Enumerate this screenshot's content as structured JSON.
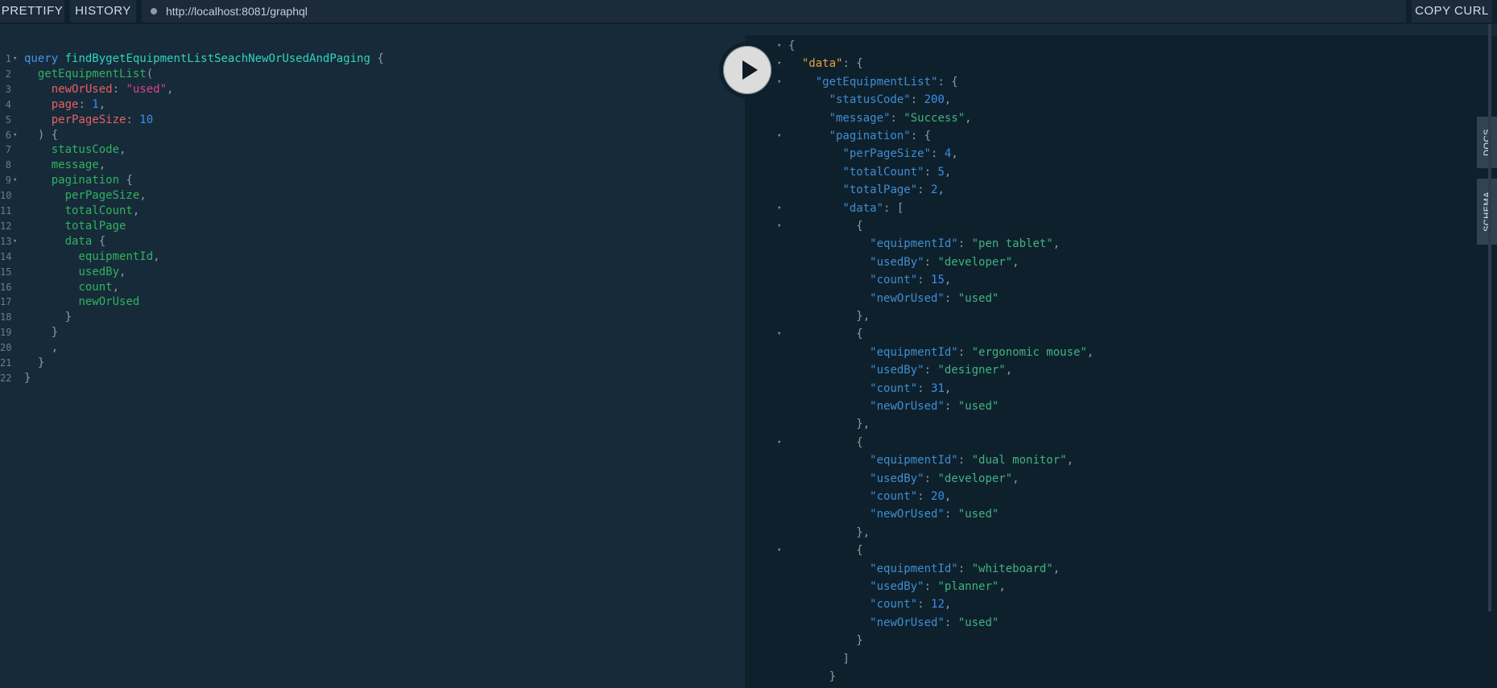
{
  "toolbar": {
    "prettify_label": "PRETTIFY",
    "history_label": "HISTORY",
    "endpoint_url": "http://localhost:8081/graphql",
    "copy_curl_label": "COPY CURL"
  },
  "sidebar_tabs": {
    "docs_label": "DOCS",
    "schema_label": "SCHEMA"
  },
  "query_lines": [
    {
      "n": "1",
      "fold": true,
      "tokens": [
        {
          "t": "query",
          "c": "kw"
        },
        {
          "t": " "
        },
        {
          "t": "findBygetEquipmentListSeachNewOrUsedAndPaging",
          "c": "fn"
        },
        {
          "t": " {",
          "c": "pun"
        }
      ]
    },
    {
      "n": "2",
      "tokens": [
        {
          "t": "  "
        },
        {
          "t": "getEquipmentList",
          "c": "fld"
        },
        {
          "t": "(",
          "c": "pun"
        }
      ]
    },
    {
      "n": "3",
      "tokens": [
        {
          "t": "    "
        },
        {
          "t": "newOrUsed",
          "c": "arg"
        },
        {
          "t": ": ",
          "c": "pun"
        },
        {
          "t": "\"used\"",
          "c": "str"
        },
        {
          "t": ",",
          "c": "pun"
        }
      ]
    },
    {
      "n": "4",
      "tokens": [
        {
          "t": "    "
        },
        {
          "t": "page",
          "c": "arg"
        },
        {
          "t": ": ",
          "c": "pun"
        },
        {
          "t": "1",
          "c": "num"
        },
        {
          "t": ",",
          "c": "pun"
        }
      ]
    },
    {
      "n": "5",
      "tokens": [
        {
          "t": "    "
        },
        {
          "t": "perPageSize",
          "c": "arg"
        },
        {
          "t": ": ",
          "c": "pun"
        },
        {
          "t": "10",
          "c": "num"
        }
      ]
    },
    {
      "n": "6",
      "fold": true,
      "tokens": [
        {
          "t": "  "
        },
        {
          "t": ") {",
          "c": "pun"
        }
      ]
    },
    {
      "n": "7",
      "tokens": [
        {
          "t": "    "
        },
        {
          "t": "statusCode",
          "c": "fld"
        },
        {
          "t": ",",
          "c": "pun"
        }
      ]
    },
    {
      "n": "8",
      "tokens": [
        {
          "t": "    "
        },
        {
          "t": "message",
          "c": "fld"
        },
        {
          "t": ",",
          "c": "pun"
        }
      ]
    },
    {
      "n": "9",
      "fold": true,
      "tokens": [
        {
          "t": "    "
        },
        {
          "t": "pagination",
          "c": "fld"
        },
        {
          "t": " {",
          "c": "pun"
        }
      ]
    },
    {
      "n": "10",
      "tokens": [
        {
          "t": "      "
        },
        {
          "t": "perPageSize",
          "c": "fld"
        },
        {
          "t": ",",
          "c": "pun"
        }
      ]
    },
    {
      "n": "11",
      "tokens": [
        {
          "t": "      "
        },
        {
          "t": "totalCount",
          "c": "fld"
        },
        {
          "t": ",",
          "c": "pun"
        }
      ]
    },
    {
      "n": "12",
      "tokens": [
        {
          "t": "      "
        },
        {
          "t": "totalPage",
          "c": "fld"
        }
      ]
    },
    {
      "n": "13",
      "fold": true,
      "tokens": [
        {
          "t": "      "
        },
        {
          "t": "data",
          "c": "fld"
        },
        {
          "t": " {",
          "c": "pun"
        }
      ]
    },
    {
      "n": "14",
      "tokens": [
        {
          "t": "        "
        },
        {
          "t": "equipmentId",
          "c": "fld"
        },
        {
          "t": ",",
          "c": "pun"
        }
      ]
    },
    {
      "n": "15",
      "tokens": [
        {
          "t": "        "
        },
        {
          "t": "usedBy",
          "c": "fld"
        },
        {
          "t": ",",
          "c": "pun"
        }
      ]
    },
    {
      "n": "16",
      "tokens": [
        {
          "t": "        "
        },
        {
          "t": "count",
          "c": "fld"
        },
        {
          "t": ",",
          "c": "pun"
        }
      ]
    },
    {
      "n": "17",
      "tokens": [
        {
          "t": "        "
        },
        {
          "t": "newOrUsed",
          "c": "fld"
        }
      ]
    },
    {
      "n": "18",
      "tokens": [
        {
          "t": "      "
        },
        {
          "t": "}",
          "c": "pun"
        }
      ]
    },
    {
      "n": "19",
      "tokens": [
        {
          "t": "    "
        },
        {
          "t": "}",
          "c": "pun"
        }
      ]
    },
    {
      "n": "20",
      "tokens": [
        {
          "t": "    "
        },
        {
          "t": ",",
          "c": "pun"
        }
      ]
    },
    {
      "n": "21",
      "tokens": [
        {
          "t": "  "
        },
        {
          "t": "}",
          "c": "pun"
        }
      ]
    },
    {
      "n": "22",
      "tokens": [
        {
          "t": "}",
          "c": "pun"
        }
      ]
    }
  ],
  "result_lines": [
    {
      "fold": true,
      "tokens": [
        {
          "t": "{",
          "c": "pun"
        }
      ]
    },
    {
      "fold": true,
      "tokens": [
        {
          "t": "  "
        },
        {
          "t": "\"data\"",
          "c": "rkey-data"
        },
        {
          "t": ": {",
          "c": "pun"
        }
      ]
    },
    {
      "fold": true,
      "tokens": [
        {
          "t": "    "
        },
        {
          "t": "\"getEquipmentList\"",
          "c": "key"
        },
        {
          "t": ": {",
          "c": "pun"
        }
      ]
    },
    {
      "tokens": [
        {
          "t": "      "
        },
        {
          "t": "\"statusCode\"",
          "c": "key"
        },
        {
          "t": ": ",
          "c": "pun"
        },
        {
          "t": "200",
          "c": "rnum"
        },
        {
          "t": ",",
          "c": "pun"
        }
      ]
    },
    {
      "tokens": [
        {
          "t": "      "
        },
        {
          "t": "\"message\"",
          "c": "key"
        },
        {
          "t": ": ",
          "c": "pun"
        },
        {
          "t": "\"Success\"",
          "c": "rstr"
        },
        {
          "t": ",",
          "c": "pun"
        }
      ]
    },
    {
      "fold": true,
      "tokens": [
        {
          "t": "      "
        },
        {
          "t": "\"pagination\"",
          "c": "key"
        },
        {
          "t": ": {",
          "c": "pun"
        }
      ]
    },
    {
      "tokens": [
        {
          "t": "        "
        },
        {
          "t": "\"perPageSize\"",
          "c": "key"
        },
        {
          "t": ": ",
          "c": "pun"
        },
        {
          "t": "4",
          "c": "rnum"
        },
        {
          "t": ",",
          "c": "pun"
        }
      ]
    },
    {
      "tokens": [
        {
          "t": "        "
        },
        {
          "t": "\"totalCount\"",
          "c": "key"
        },
        {
          "t": ": ",
          "c": "pun"
        },
        {
          "t": "5",
          "c": "rnum"
        },
        {
          "t": ",",
          "c": "pun"
        }
      ]
    },
    {
      "tokens": [
        {
          "t": "        "
        },
        {
          "t": "\"totalPage\"",
          "c": "key"
        },
        {
          "t": ": ",
          "c": "pun"
        },
        {
          "t": "2",
          "c": "rnum"
        },
        {
          "t": ",",
          "c": "pun"
        }
      ]
    },
    {
      "fold": true,
      "tokens": [
        {
          "t": "        "
        },
        {
          "t": "\"data\"",
          "c": "key"
        },
        {
          "t": ": [",
          "c": "pun"
        }
      ]
    },
    {
      "fold": true,
      "tokens": [
        {
          "t": "          "
        },
        {
          "t": "{",
          "c": "pun"
        }
      ]
    },
    {
      "tokens": [
        {
          "t": "            "
        },
        {
          "t": "\"equipmentId\"",
          "c": "key"
        },
        {
          "t": ": ",
          "c": "pun"
        },
        {
          "t": "\"pen tablet\"",
          "c": "rstr"
        },
        {
          "t": ",",
          "c": "pun"
        }
      ]
    },
    {
      "tokens": [
        {
          "t": "            "
        },
        {
          "t": "\"usedBy\"",
          "c": "key"
        },
        {
          "t": ": ",
          "c": "pun"
        },
        {
          "t": "\"developer\"",
          "c": "rstr"
        },
        {
          "t": ",",
          "c": "pun"
        }
      ]
    },
    {
      "tokens": [
        {
          "t": "            "
        },
        {
          "t": "\"count\"",
          "c": "key"
        },
        {
          "t": ": ",
          "c": "pun"
        },
        {
          "t": "15",
          "c": "rnum"
        },
        {
          "t": ",",
          "c": "pun"
        }
      ]
    },
    {
      "tokens": [
        {
          "t": "            "
        },
        {
          "t": "\"newOrUsed\"",
          "c": "key"
        },
        {
          "t": ": ",
          "c": "pun"
        },
        {
          "t": "\"used\"",
          "c": "rstr"
        }
      ]
    },
    {
      "tokens": [
        {
          "t": "          "
        },
        {
          "t": "},",
          "c": "pun"
        }
      ]
    },
    {
      "fold": true,
      "tokens": [
        {
          "t": "          "
        },
        {
          "t": "{",
          "c": "pun"
        }
      ]
    },
    {
      "tokens": [
        {
          "t": "            "
        },
        {
          "t": "\"equipmentId\"",
          "c": "key"
        },
        {
          "t": ": ",
          "c": "pun"
        },
        {
          "t": "\"ergonomic mouse\"",
          "c": "rstr"
        },
        {
          "t": ",",
          "c": "pun"
        }
      ]
    },
    {
      "tokens": [
        {
          "t": "            "
        },
        {
          "t": "\"usedBy\"",
          "c": "key"
        },
        {
          "t": ": ",
          "c": "pun"
        },
        {
          "t": "\"designer\"",
          "c": "rstr"
        },
        {
          "t": ",",
          "c": "pun"
        }
      ]
    },
    {
      "tokens": [
        {
          "t": "            "
        },
        {
          "t": "\"count\"",
          "c": "key"
        },
        {
          "t": ": ",
          "c": "pun"
        },
        {
          "t": "31",
          "c": "rnum"
        },
        {
          "t": ",",
          "c": "pun"
        }
      ]
    },
    {
      "tokens": [
        {
          "t": "            "
        },
        {
          "t": "\"newOrUsed\"",
          "c": "key"
        },
        {
          "t": ": ",
          "c": "pun"
        },
        {
          "t": "\"used\"",
          "c": "rstr"
        }
      ]
    },
    {
      "tokens": [
        {
          "t": "          "
        },
        {
          "t": "},",
          "c": "pun"
        }
      ]
    },
    {
      "fold": true,
      "tokens": [
        {
          "t": "          "
        },
        {
          "t": "{",
          "c": "pun"
        }
      ]
    },
    {
      "tokens": [
        {
          "t": "            "
        },
        {
          "t": "\"equipmentId\"",
          "c": "key"
        },
        {
          "t": ": ",
          "c": "pun"
        },
        {
          "t": "\"dual monitor\"",
          "c": "rstr"
        },
        {
          "t": ",",
          "c": "pun"
        }
      ]
    },
    {
      "tokens": [
        {
          "t": "            "
        },
        {
          "t": "\"usedBy\"",
          "c": "key"
        },
        {
          "t": ": ",
          "c": "pun"
        },
        {
          "t": "\"developer\"",
          "c": "rstr"
        },
        {
          "t": ",",
          "c": "pun"
        }
      ]
    },
    {
      "tokens": [
        {
          "t": "            "
        },
        {
          "t": "\"count\"",
          "c": "key"
        },
        {
          "t": ": ",
          "c": "pun"
        },
        {
          "t": "20",
          "c": "rnum"
        },
        {
          "t": ",",
          "c": "pun"
        }
      ]
    },
    {
      "tokens": [
        {
          "t": "            "
        },
        {
          "t": "\"newOrUsed\"",
          "c": "key"
        },
        {
          "t": ": ",
          "c": "pun"
        },
        {
          "t": "\"used\"",
          "c": "rstr"
        }
      ]
    },
    {
      "tokens": [
        {
          "t": "          "
        },
        {
          "t": "},",
          "c": "pun"
        }
      ]
    },
    {
      "fold": true,
      "tokens": [
        {
          "t": "          "
        },
        {
          "t": "{",
          "c": "pun"
        }
      ]
    },
    {
      "tokens": [
        {
          "t": "            "
        },
        {
          "t": "\"equipmentId\"",
          "c": "key"
        },
        {
          "t": ": ",
          "c": "pun"
        },
        {
          "t": "\"whiteboard\"",
          "c": "rstr"
        },
        {
          "t": ",",
          "c": "pun"
        }
      ]
    },
    {
      "tokens": [
        {
          "t": "            "
        },
        {
          "t": "\"usedBy\"",
          "c": "key"
        },
        {
          "t": ": ",
          "c": "pun"
        },
        {
          "t": "\"planner\"",
          "c": "rstr"
        },
        {
          "t": ",",
          "c": "pun"
        }
      ]
    },
    {
      "tokens": [
        {
          "t": "            "
        },
        {
          "t": "\"count\"",
          "c": "key"
        },
        {
          "t": ": ",
          "c": "pun"
        },
        {
          "t": "12",
          "c": "rnum"
        },
        {
          "t": ",",
          "c": "pun"
        }
      ]
    },
    {
      "tokens": [
        {
          "t": "            "
        },
        {
          "t": "\"newOrUsed\"",
          "c": "key"
        },
        {
          "t": ": ",
          "c": "pun"
        },
        {
          "t": "\"used\"",
          "c": "rstr"
        }
      ]
    },
    {
      "tokens": [
        {
          "t": "          "
        },
        {
          "t": "}",
          "c": "pun"
        }
      ]
    },
    {
      "tokens": [
        {
          "t": "        "
        },
        {
          "t": "]",
          "c": "pun"
        }
      ]
    },
    {
      "tokens": [
        {
          "t": "      "
        },
        {
          "t": "}",
          "c": "pun"
        }
      ]
    }
  ]
}
